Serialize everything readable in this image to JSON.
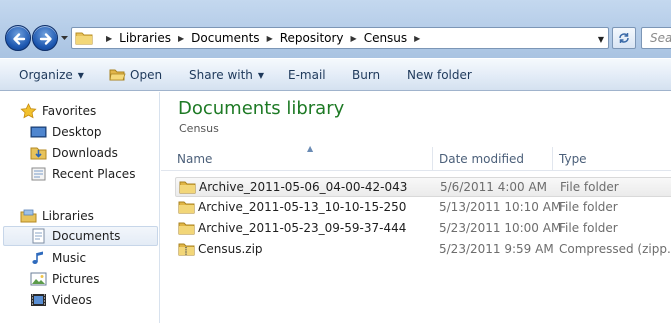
{
  "window": {
    "breadcrumbs": [
      "Libraries",
      "Documents",
      "Repository",
      "Census"
    ],
    "search_placeholder": "Sear"
  },
  "toolbar": {
    "organize": "Organize",
    "open": "Open",
    "share_with": "Share with",
    "email": "E-mail",
    "burn": "Burn",
    "new_folder": "New folder"
  },
  "nav": {
    "favorites_header": "Favorites",
    "favorites": [
      "Desktop",
      "Downloads",
      "Recent Places"
    ],
    "libraries_header": "Libraries",
    "libraries": [
      "Documents",
      "Music",
      "Pictures",
      "Videos"
    ],
    "selected": "Documents"
  },
  "main": {
    "title": "Documents library",
    "subtitle": "Census",
    "columns": {
      "name": "Name",
      "date": "Date modified",
      "type": "Type"
    },
    "rows": [
      {
        "name": "Archive_2011-05-06_04-00-42-043",
        "date": "5/6/2011 4:00 AM",
        "type": "File folder",
        "icon": "folder-icon"
      },
      {
        "name": "Archive_2011-05-13_10-10-15-250",
        "date": "5/13/2011 10:10 AM",
        "type": "File folder",
        "icon": "folder-icon"
      },
      {
        "name": "Archive_2011-05-23_09-59-37-444",
        "date": "5/23/2011 10:00 AM",
        "type": "File folder",
        "icon": "folder-icon"
      },
      {
        "name": "Census.zip",
        "date": "5/23/2011 9:59 AM",
        "type": "Compressed (zipp...",
        "icon": "zip-folder-icon"
      }
    ]
  },
  "colors": {
    "accent_title": "#1e7a25",
    "toolbar_text": "#1e395b",
    "titlebar": "#b3cbe7"
  }
}
